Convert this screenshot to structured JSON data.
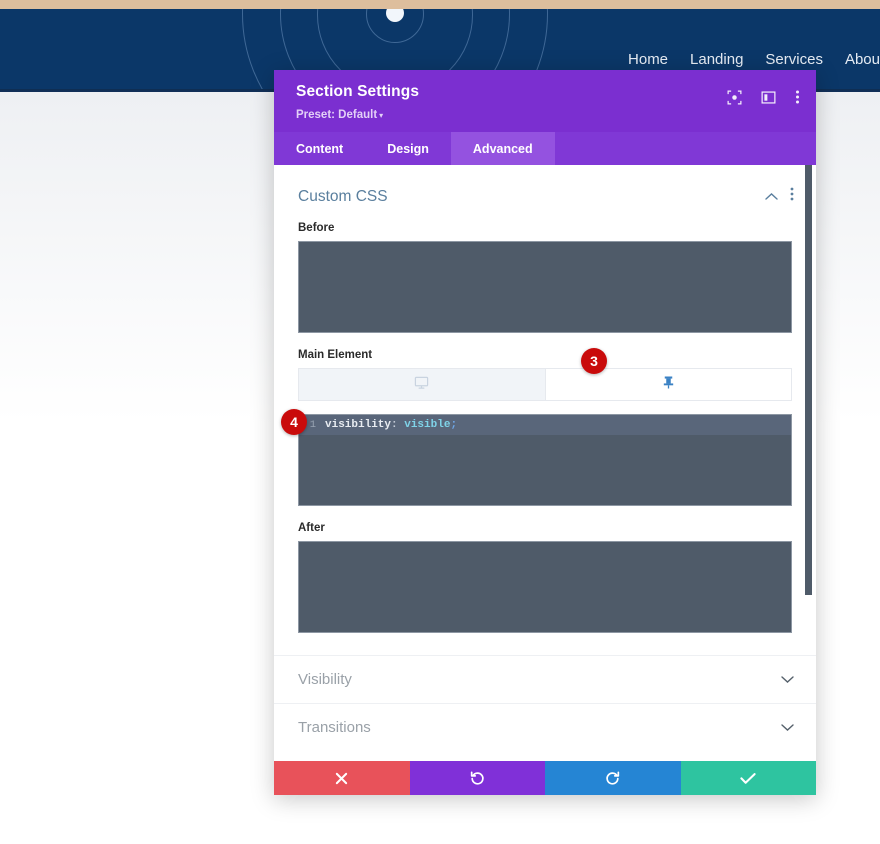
{
  "background": {
    "nav": {
      "items": [
        {
          "label": "Home"
        },
        {
          "label": "Landing"
        },
        {
          "label": "Services"
        },
        {
          "label": "Abou"
        }
      ]
    },
    "colors": {
      "top_strip": "#ddbe9d",
      "hero": "#0b3768"
    }
  },
  "modal": {
    "header": {
      "title": "Section Settings",
      "preset_label": "Preset: Default",
      "preset_caret": "▾",
      "icons": [
        {
          "name": "focus-target-icon"
        },
        {
          "name": "layout-panel-icon"
        },
        {
          "name": "more-vertical-icon"
        }
      ]
    },
    "tabs": [
      {
        "label": "Content",
        "active": false
      },
      {
        "label": "Design",
        "active": false
      },
      {
        "label": "Advanced",
        "active": true
      }
    ],
    "section": {
      "title": "Custom CSS",
      "collapse_icon": "chevron-up-icon",
      "menu_icon": "more-vertical-icon"
    },
    "fields": {
      "before": {
        "label": "Before",
        "value": ""
      },
      "main_element": {
        "label": "Main Element",
        "tabs": [
          {
            "name": "desktop-icon",
            "active": true
          },
          {
            "name": "pin-icon",
            "active": false
          }
        ],
        "code": {
          "line_number": "1",
          "property": "visibility",
          "colon": ": ",
          "value": "visible",
          "semicolon": ";"
        }
      },
      "after": {
        "label": "After",
        "value": ""
      }
    },
    "accordions": [
      {
        "label": "Visibility",
        "icon": "chevron-down-icon"
      },
      {
        "label": "Transitions",
        "icon": "chevron-down-icon"
      }
    ],
    "footer_buttons": [
      {
        "name": "cancel-button",
        "icon": "close-x-icon",
        "color": "#e8525a"
      },
      {
        "name": "undo-button",
        "icon": "undo-arrow-icon",
        "color": "#8030d8"
      },
      {
        "name": "redo-button",
        "icon": "redo-arrow-icon",
        "color": "#2585d4"
      },
      {
        "name": "save-button",
        "icon": "checkmark-icon",
        "color": "#2ec4a0"
      }
    ]
  },
  "annotations": [
    {
      "label": "3"
    },
    {
      "label": "4"
    }
  ]
}
